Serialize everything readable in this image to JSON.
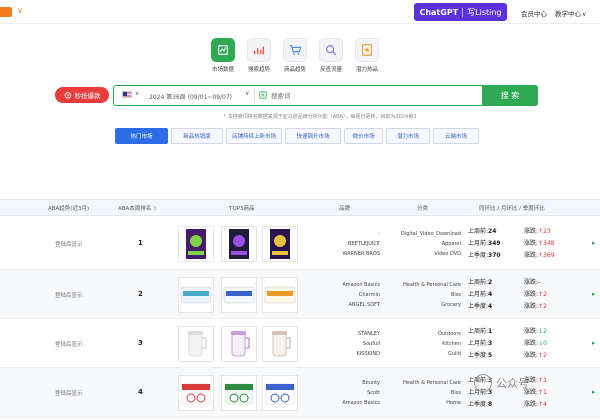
{
  "header": {
    "gpt_label": "ChatGPT",
    "listing_label": "写Listing",
    "nav": [
      "会员中心",
      "教学中心"
    ],
    "nav_chevron": "∨"
  },
  "tools": [
    {
      "label": "市场数据",
      "color": "#2eaa55",
      "icon": "chart-card-icon"
    },
    {
      "label": "搜索趋势",
      "color": "#e8533b",
      "icon": "trend-bars-icon"
    },
    {
      "label": "商品趋势",
      "color": "#4b8fe8",
      "icon": "cart-icon"
    },
    {
      "label": "反查流量",
      "color": "#8a7fe0",
      "icon": "magnify-icon"
    },
    {
      "label": "潜力热品",
      "color": "#f0a030",
      "icon": "star-doc-icon"
    }
  ],
  "search": {
    "hot_label": "秒抢爆款",
    "week": "2024 第36周 (09/01~09/07)",
    "placeholder": "搜索词",
    "button": "搜 索",
    "note": "* 本搜索词排名数据来源于亚马逊品牌分析功能（ABA），每周日更新，目前为2024第3"
  },
  "tabs": [
    "热门市场",
    "新品热销版",
    "店铺持续上新市场",
    "快速飙升市场",
    "微价市场",
    "潜力市场",
    "云端市场"
  ],
  "table": {
    "headers": [
      "ABA趋势(近3月)",
      "ABA本周排名",
      "TOP3商品",
      "品牌",
      "分类",
      "同环比 / 月环比 / 季度环比"
    ],
    "trend_placeholder": "登陆后显示",
    "rows": [
      {
        "rank": "1",
        "brands": [
          "-",
          "BEETLEJUICE",
          "WARNER BROS"
        ],
        "cats": [
          "Digital_Video_Download",
          "Apparel",
          "Video DVD"
        ],
        "hist": [
          {
            "label": "上周前:",
            "val": "24"
          },
          {
            "label": "上月前:",
            "val": "349"
          },
          {
            "label": "上季度:",
            "val": "370"
          }
        ],
        "chg": [
          {
            "label": "涨跌:",
            "dir": "up",
            "val": "23"
          },
          {
            "label": "涨跌:",
            "dir": "up",
            "val": "348"
          },
          {
            "label": "涨跌:",
            "dir": "up",
            "val": "369"
          }
        ]
      },
      {
        "rank": "2",
        "brands": [
          "Amazon Basics",
          "Charmin",
          "ANGEL SOFT"
        ],
        "cats": [
          "Health & Personal Care",
          "Biss",
          "Grocery"
        ],
        "hist": [
          {
            "label": "上周前:",
            "val": "2"
          },
          {
            "label": "上月前:",
            "val": "4"
          },
          {
            "label": "上季度:",
            "val": "4"
          }
        ],
        "chg": [
          {
            "label": "涨跌:",
            "dir": "none",
            "val": "-"
          },
          {
            "label": "涨跌:",
            "dir": "up",
            "val": "2"
          },
          {
            "label": "涨跌:",
            "dir": "up",
            "val": "2"
          }
        ]
      },
      {
        "rank": "3",
        "brands": [
          "STANLEY",
          "Soufull",
          "KISSKIND"
        ],
        "cats": [
          "Outdoors",
          "Kitchen",
          "Guild"
        ],
        "hist": [
          {
            "label": "上周前:",
            "val": "1"
          },
          {
            "label": "上月前:",
            "val": "3"
          },
          {
            "label": "上季度:",
            "val": "5"
          }
        ],
        "chg": [
          {
            "label": "涨跌:",
            "dir": "dn",
            "val": "2"
          },
          {
            "label": "涨跌:",
            "dir": "dn",
            "val": "0"
          },
          {
            "label": "涨跌:",
            "dir": "up",
            "val": "2"
          }
        ]
      },
      {
        "rank": "4",
        "brands": [
          "Bounty",
          "Scott",
          "Amazon Basics"
        ],
        "cats": [
          "Health & Personal Care",
          "Biss",
          "Home"
        ],
        "hist": [
          {
            "label": "上周前:",
            "val": "3"
          },
          {
            "label": "上月前:",
            "val": "3"
          },
          {
            "label": "上季度:",
            "val": "8"
          }
        ],
        "chg": [
          {
            "label": "涨跌:",
            "dir": "up",
            "val": "1"
          },
          {
            "label": "涨跌:",
            "dir": "up",
            "val": "1"
          },
          {
            "label": "涨跌:",
            "dir": "up",
            "val": "4"
          }
        ]
      }
    ]
  },
  "watermark": "公众号"
}
